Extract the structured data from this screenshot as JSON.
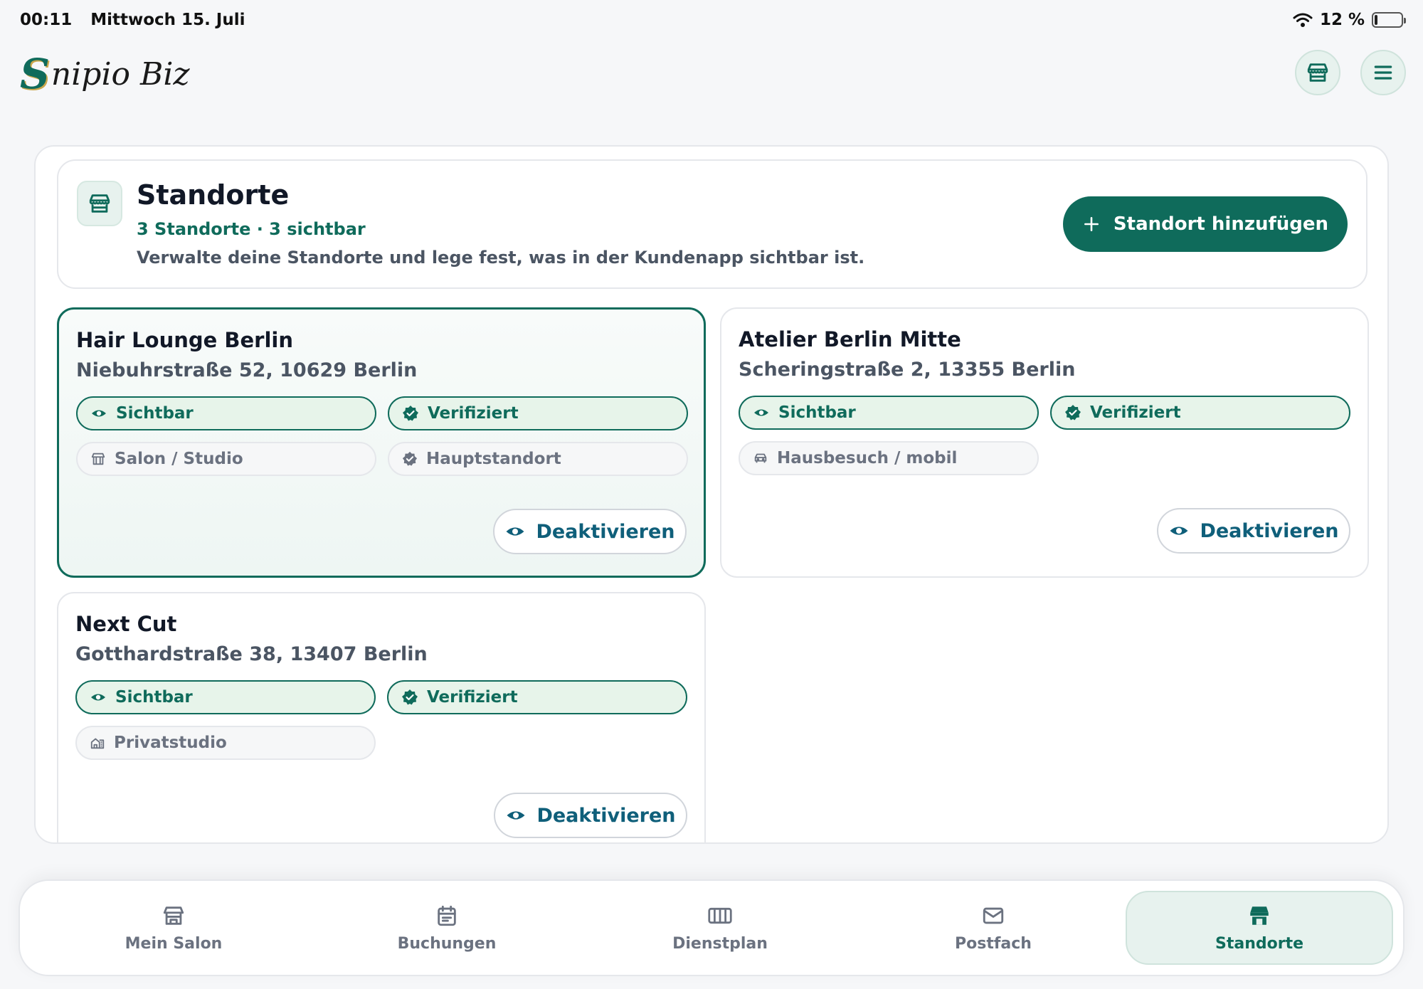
{
  "status": {
    "time": "00:11",
    "date": "Mittwoch 15. Juli",
    "battery": "12 %",
    "battery_level": 0.12
  },
  "app": {
    "logo_initial": "S",
    "logo_rest": "nipio Biz"
  },
  "header": {
    "title": "Standorte",
    "subtitle": "3 Standorte · 3 sichtbar",
    "description": "Verwalte deine Standorte und lege fest, was in der Kundenapp sichtbar ist.",
    "add_label": "Standort hinzufügen"
  },
  "locations": [
    {
      "name": "Hair Lounge Berlin",
      "address": "Niebuhrstraße 52, 10629 Berlin",
      "visible": "Sichtbar",
      "verified": "Verifiziert",
      "type": "Salon / Studio",
      "extra": "Hauptstandort",
      "action": "Deaktivieren"
    },
    {
      "name": "Atelier Berlin Mitte",
      "address": "Scheringstraße 2, 13355 Berlin",
      "visible": "Sichtbar",
      "verified": "Verifiziert",
      "type": "Hausbesuch / mobil",
      "action": "Deaktivieren"
    },
    {
      "name": "Next Cut",
      "address": "Gotthardstraße 38, 13407 Berlin",
      "visible": "Sichtbar",
      "verified": "Verifiziert",
      "type": "Privatstudio",
      "action": "Deaktivieren"
    }
  ],
  "nav": [
    {
      "label": "Mein Salon",
      "icon": "store-icon"
    },
    {
      "label": "Buchungen",
      "icon": "calendar-icon"
    },
    {
      "label": "Dienstplan",
      "icon": "schedule-grid-icon"
    },
    {
      "label": "Postfach",
      "icon": "mail-icon"
    },
    {
      "label": "Standorte",
      "icon": "storefront-icon",
      "active": true
    }
  ],
  "colors": {
    "accent": "#0f6b5b",
    "link": "#0f5f7a",
    "chip_bg": "#e7f4ea"
  }
}
